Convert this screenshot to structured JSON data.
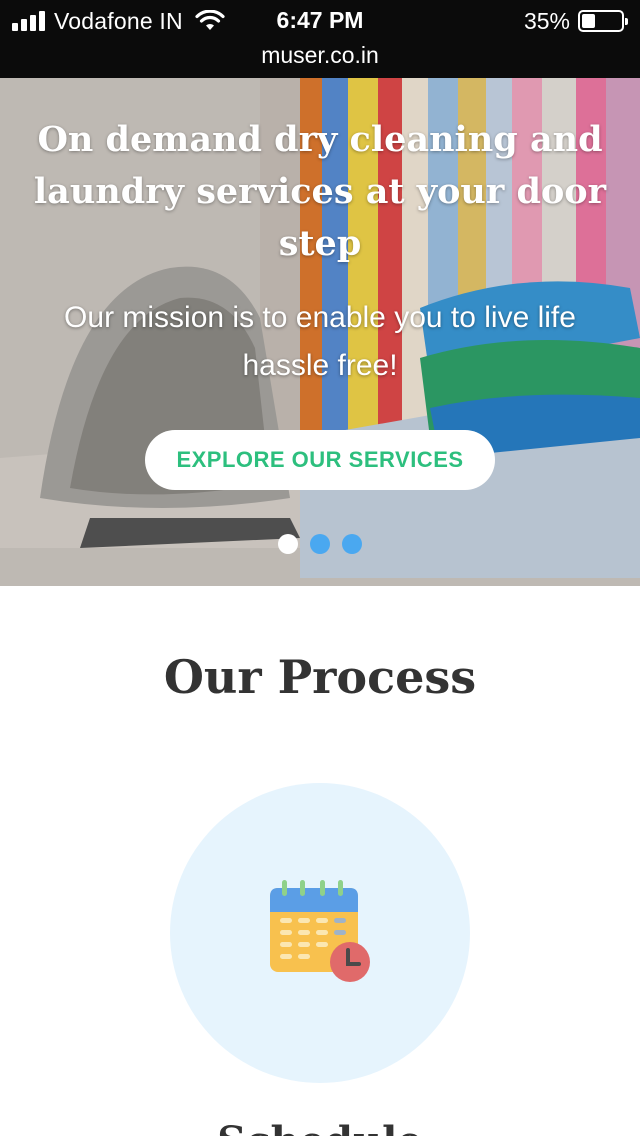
{
  "status_bar": {
    "carrier": "Vodafone IN",
    "time": "6:47 PM",
    "battery_percent": "35%",
    "battery_level": 0.35,
    "url": "muser.co.in",
    "icons": [
      "signal-icon",
      "wifi-icon",
      "battery-icon"
    ]
  },
  "hero": {
    "title": "On demand dry cleaning and laundry services at your door step",
    "subtitle": "Our mission is to enable you to live life hassle free!",
    "cta_label": "EXPLORE OUR SERVICES",
    "slides_total": 3,
    "active_slide": 1
  },
  "process": {
    "title": "Our Process",
    "step_icon": "calendar-clock-icon",
    "step_title": "Schedule"
  },
  "colors": {
    "accent_green": "#2dbf7e",
    "dot_blue": "#4aa8f0",
    "circle_bg": "#e6f4fd",
    "heading_text": "#333333"
  }
}
